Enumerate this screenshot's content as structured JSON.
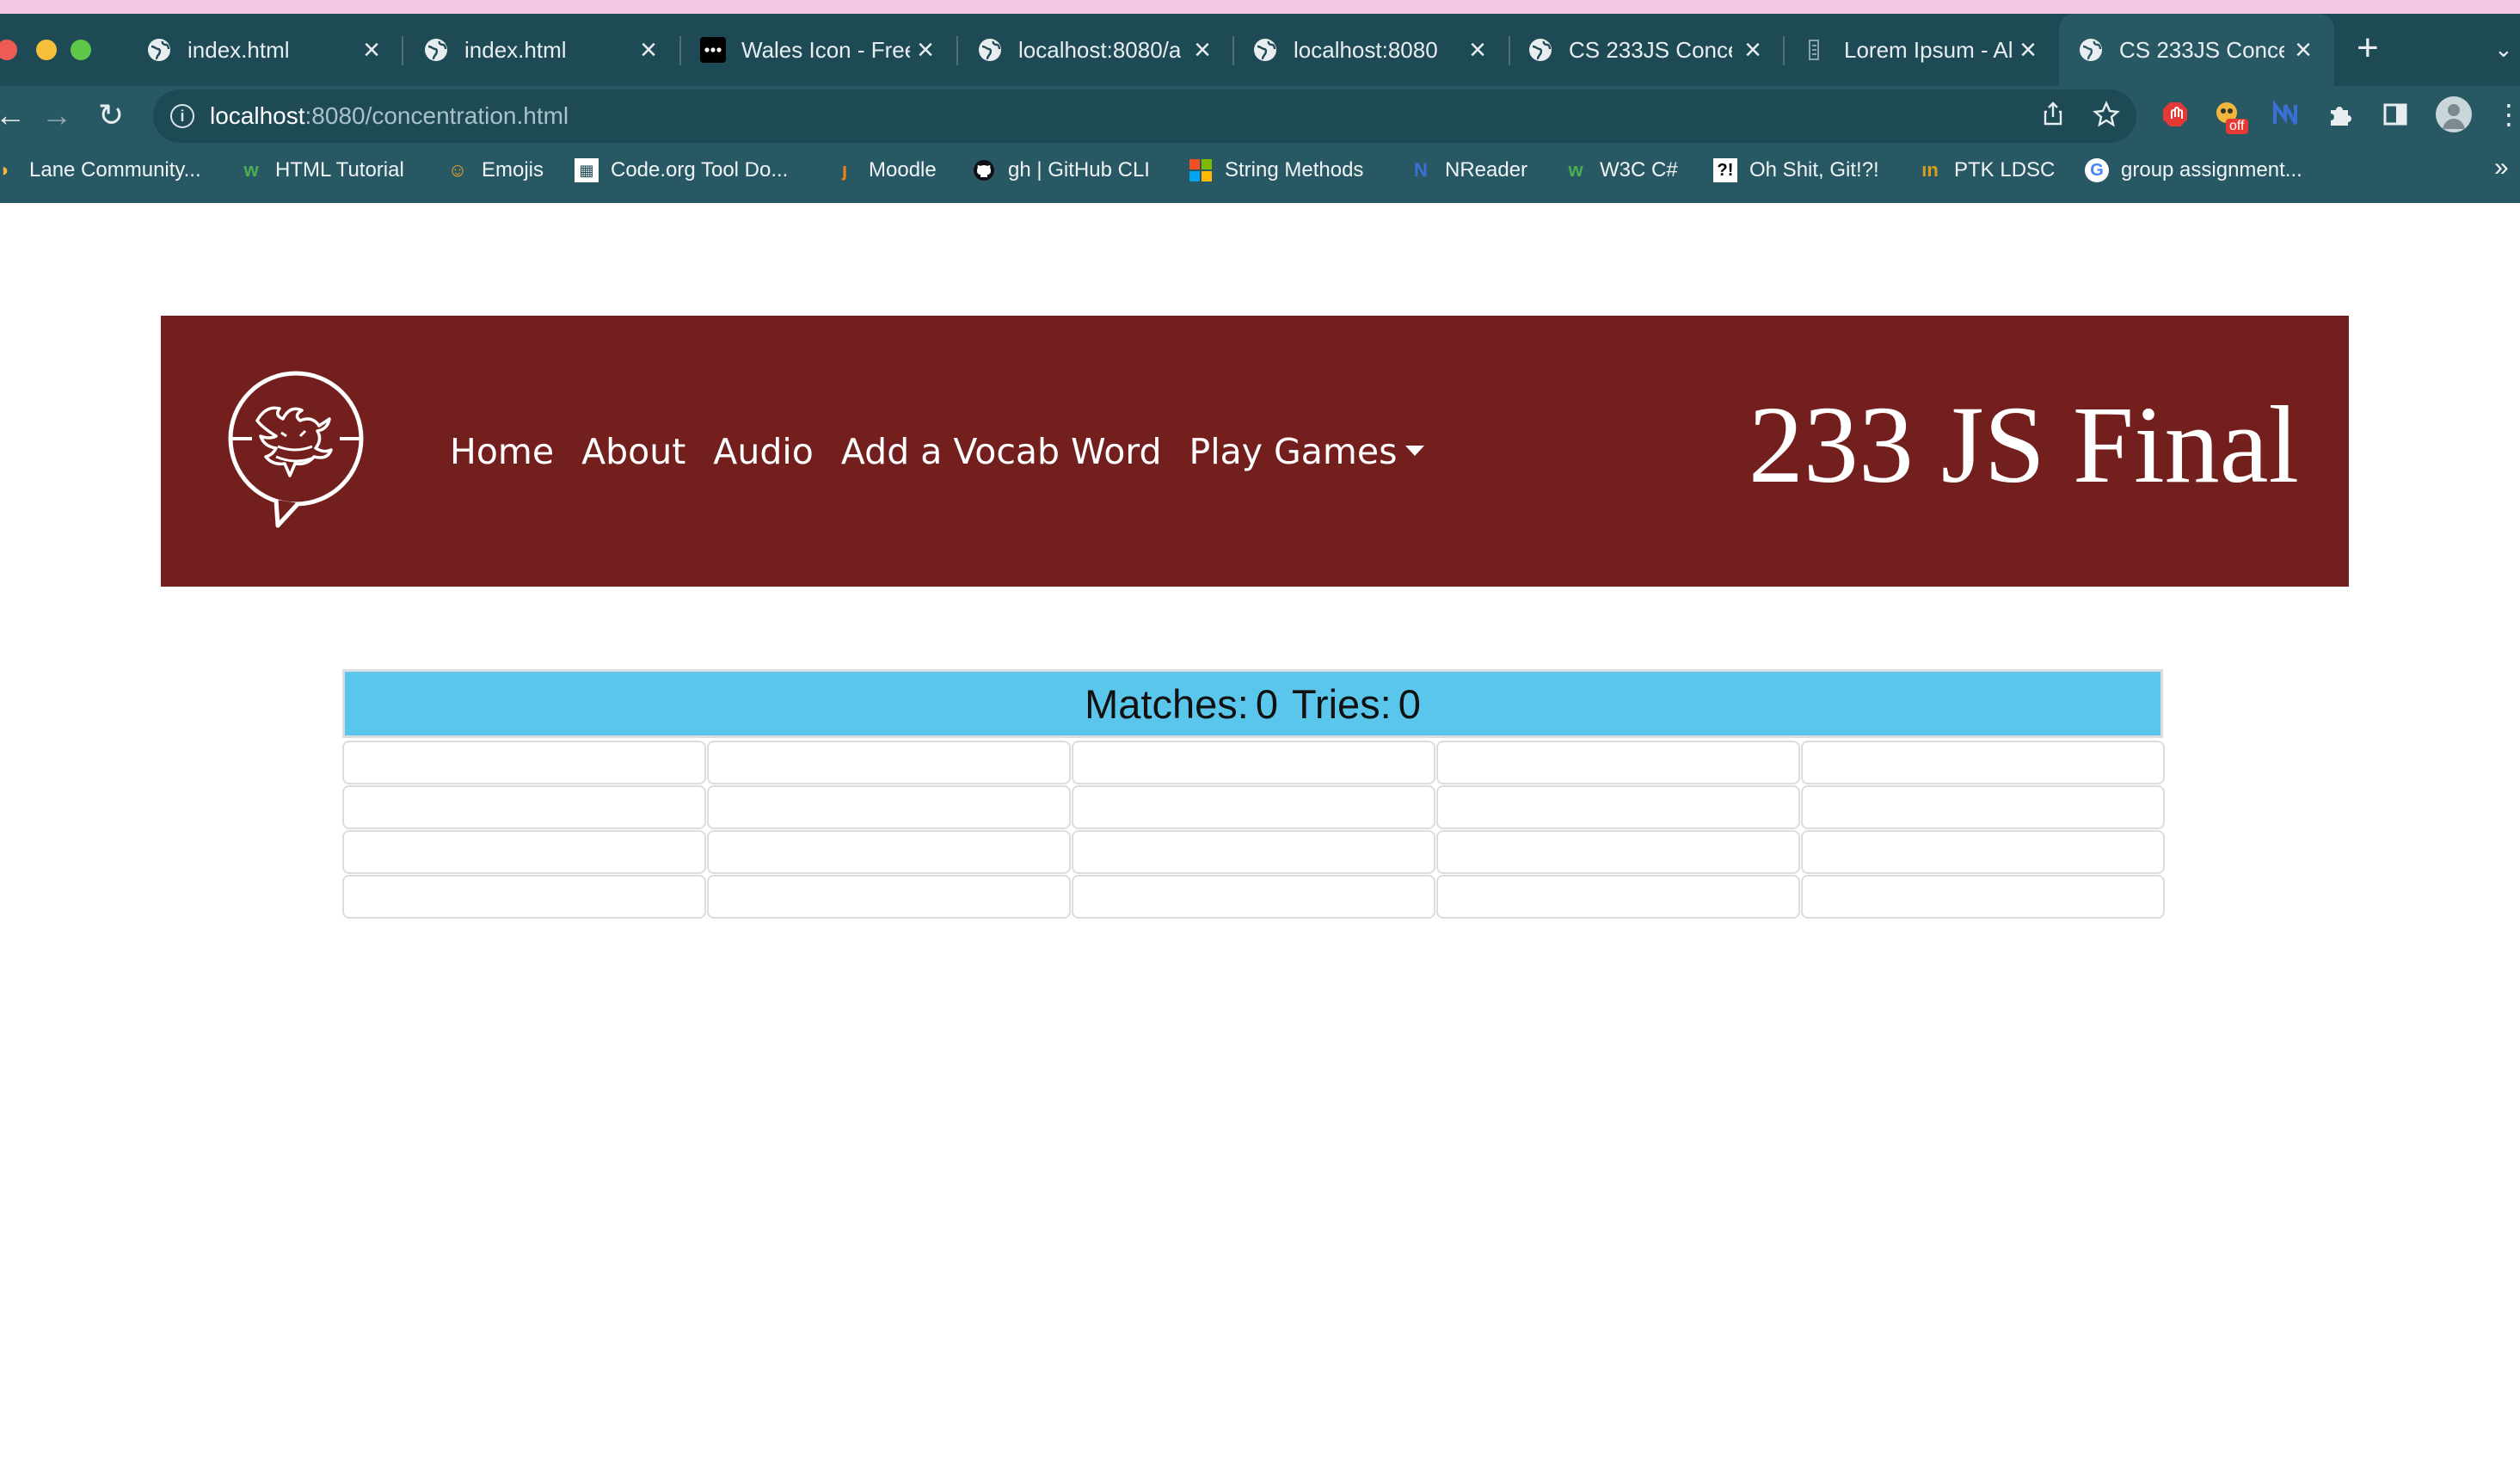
{
  "browser": {
    "tabs": [
      {
        "title": "index.html",
        "icon": "globe-icon",
        "active": false
      },
      {
        "title": "index.html",
        "icon": "globe-icon",
        "active": false
      },
      {
        "title": "Wales Icon - Free",
        "icon": "dots-icon",
        "active": false
      },
      {
        "title": "localhost:8080/a",
        "icon": "globe-icon",
        "active": false
      },
      {
        "title": "localhost:8080",
        "icon": "globe-icon",
        "active": false
      },
      {
        "title": "CS 233JS Conce",
        "icon": "globe-icon",
        "active": false
      },
      {
        "title": "Lorem Ipsum - Al",
        "icon": "page-icon",
        "active": false
      },
      {
        "title": "CS 233JS Conce",
        "icon": "globe-icon",
        "active": true
      }
    ],
    "url_host": "localhost",
    "url_rest": ":8080/concentration.html",
    "bookmarks": [
      "Lane Community...",
      "HTML Tutorial",
      "Emojis",
      "Code.org Tool Do...",
      "Moodle",
      "gh | GitHub CLI",
      "String Methods",
      "NReader",
      "W3C C#",
      "Oh Shit, Git!?!",
      "PTK LDSC",
      "group assignment..."
    ],
    "extension_badge": "off"
  },
  "site": {
    "nav": [
      "Home",
      "About",
      "Audio",
      "Add a Vocab Word",
      "Play Games"
    ],
    "title": "233 JS Final",
    "header_color": "#731f1e"
  },
  "game": {
    "matches_label": "Matches:",
    "matches": "0",
    "tries_label": "Tries:",
    "tries": "0",
    "score_color": "#5bc6ec",
    "card_count": 20
  }
}
